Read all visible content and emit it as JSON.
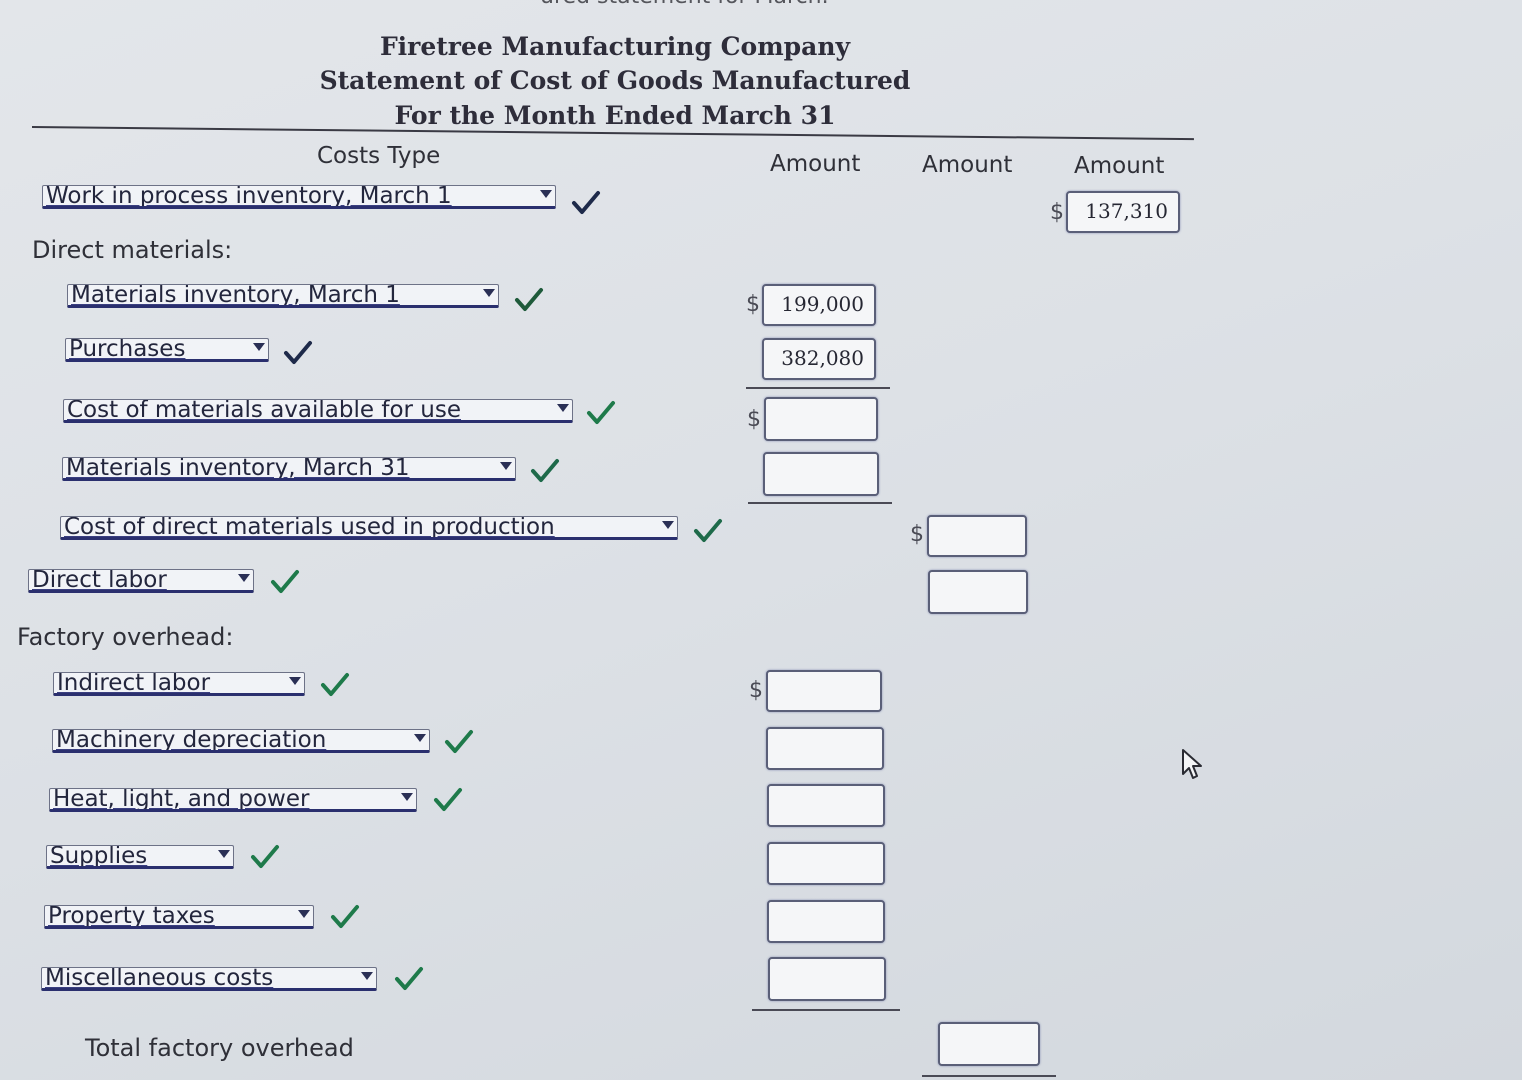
{
  "page": {
    "cut_title": "ured statement for March."
  },
  "header": {
    "company": "Firetree Manufacturing Company",
    "statement": "Statement of Cost of Goods Manufactured",
    "period": "For the Month Ended March 31"
  },
  "columns": {
    "costs_type": "Costs Type",
    "amount1": "Amount",
    "amount2": "Amount",
    "amount3": "Amount"
  },
  "rows": {
    "wip_begin": {
      "label": "Work in process inventory, March 1",
      "value": "137,310",
      "currency": "$"
    },
    "direct_materials_heading": "Direct materials:",
    "materials_begin": {
      "label": "Materials inventory, March 1",
      "value": "199,000",
      "currency": "$"
    },
    "purchases": {
      "label": "Purchases",
      "value": "382,080"
    },
    "available": {
      "label": "Cost of materials available for use",
      "value": "",
      "currency": "$"
    },
    "materials_end": {
      "label": "Materials inventory, March 31",
      "value": ""
    },
    "dm_used": {
      "label": "Cost of direct materials used in production",
      "value": "",
      "currency": "$"
    },
    "direct_labor": {
      "label": "Direct labor",
      "value": ""
    },
    "factory_overhead_heading": "Factory overhead:",
    "indirect_labor": {
      "label": "Indirect labor",
      "value": "",
      "currency": "$"
    },
    "machinery_dep": {
      "label": "Machinery depreciation",
      "value": ""
    },
    "heat_light": {
      "label": "Heat, light, and power",
      "value": ""
    },
    "supplies": {
      "label": "Supplies",
      "value": ""
    },
    "property_taxes": {
      "label": "Property taxes",
      "value": ""
    },
    "misc_costs": {
      "label": "Miscellaneous costs",
      "value": ""
    },
    "total_overhead": {
      "label": "Total factory overhead",
      "value": ""
    }
  },
  "colors": {
    "check": "#1e7a4a",
    "dropdown_border": "#2a2f6e"
  }
}
